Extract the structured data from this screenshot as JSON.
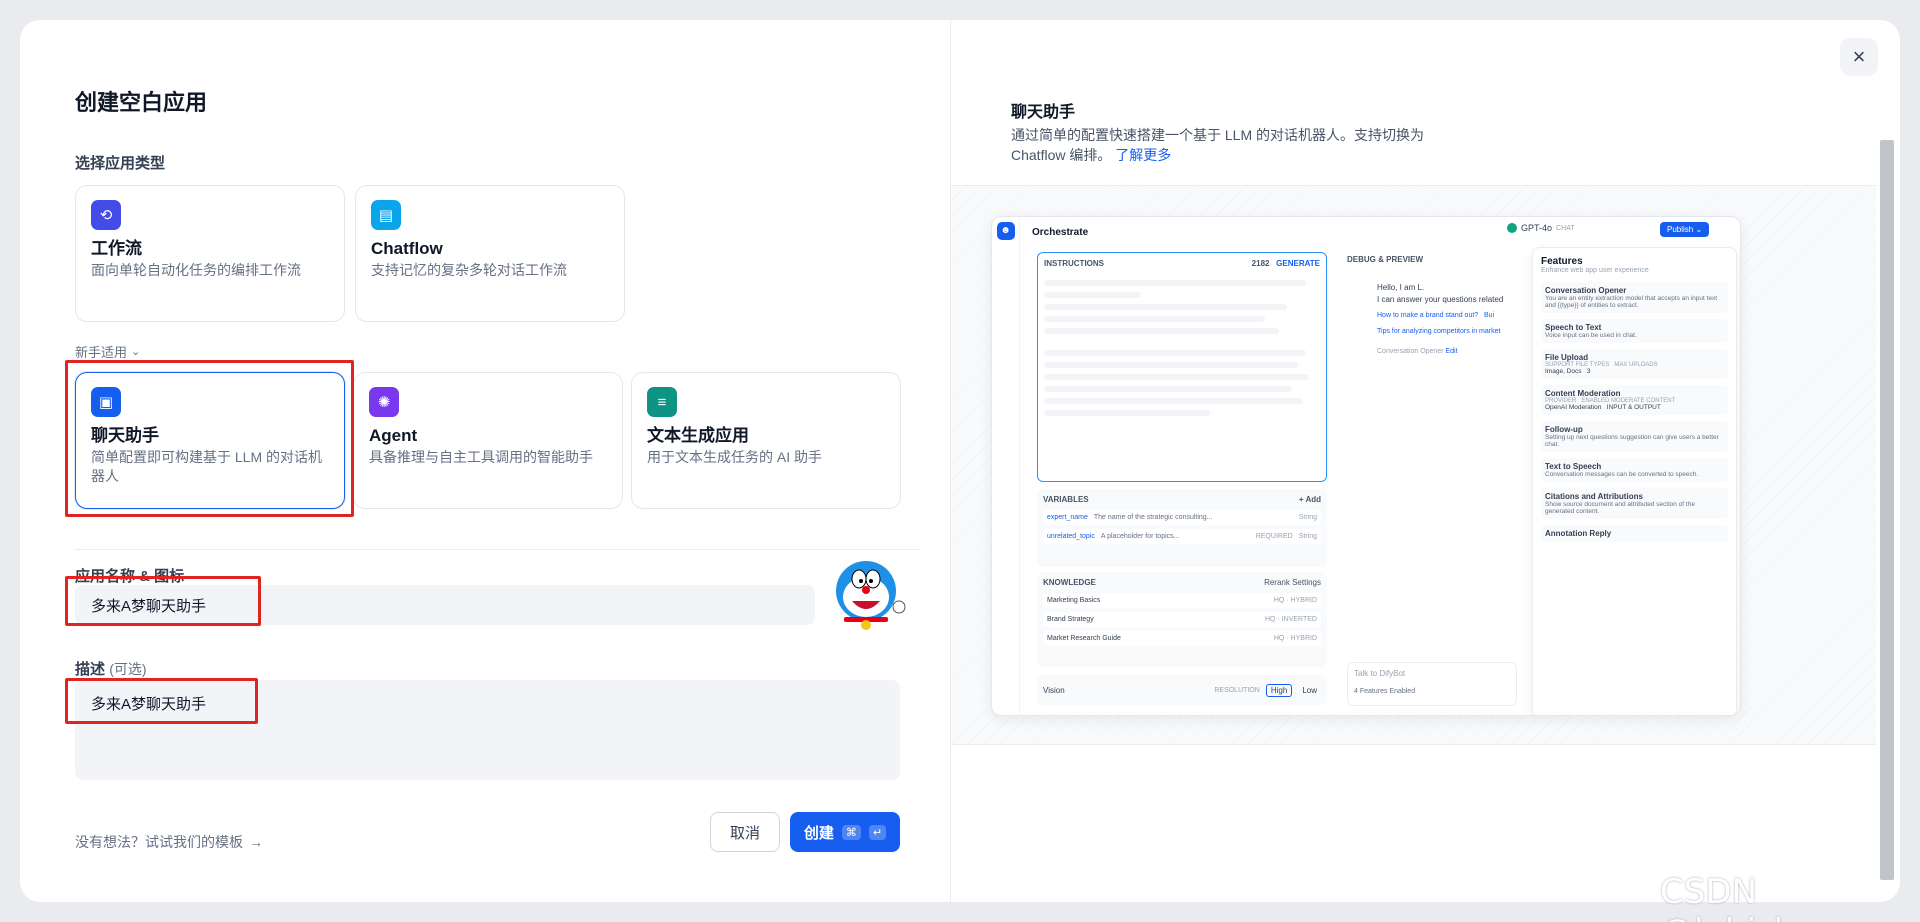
{
  "dialog": {
    "title": "创建空白应用",
    "type_label": "选择应用类型",
    "beginner_label": "新手适用",
    "name_label": "应用名称 & 图标",
    "name_value": "多来A梦聊天助手",
    "desc_label": "描述",
    "desc_optional": "(可选)",
    "desc_value": "多来A梦聊天助手",
    "template_link": "没有想法？试试我们的模板",
    "cancel_label": "取消",
    "create_label": "创建",
    "create_kbd_1": "⌘",
    "create_kbd_2": "↵"
  },
  "app_types": [
    {
      "name": "工作流",
      "desc": "面向单轮自动化任务的编排工作流",
      "icon": "workflow-icon",
      "color": "#444ce7"
    },
    {
      "name": "Chatflow",
      "desc": "支持记忆的复杂多轮对话工作流",
      "icon": "chatflow-icon",
      "color": "#0ba5ec"
    }
  ],
  "beginner_types": [
    {
      "name": "聊天助手",
      "desc": "简单配置即可构建基于 LLM 的对话机器人",
      "icon": "chatbot-icon",
      "color": "#155eef"
    },
    {
      "name": "Agent",
      "desc": "具备推理与自主工具调用的智能助手",
      "icon": "agent-icon",
      "color": "#7839ee"
    },
    {
      "name": "文本生成应用",
      "desc": "用于文本生成任务的 AI 助手",
      "icon": "text-generation-icon",
      "color": "#0e9384"
    }
  ],
  "preview": {
    "title": "聊天助手",
    "desc": "通过简单的配置快速搭建一个基于 LLM 的对话机器人。支持切换为 Chatflow 编排。",
    "learn_more": "了解更多",
    "orchestrate": "Orchestrate",
    "model": "GPT-4o",
    "model_tag": "CHAT",
    "publish": "Publish",
    "instructions": "INSTRUCTIONS",
    "instr_count": "2182",
    "generate": "GENERATE",
    "debug": "DEBUG & PREVIEW",
    "hello": "Hello, I am L.",
    "hello2": "I can answer your questions related",
    "q1": "How to make a brand stand out?",
    "q1b": "Bui",
    "q2": "Tips for analyzing competitors in market",
    "opener": "Conversation Opener",
    "edit": "Edit",
    "variables": "VARIABLES",
    "add": "+ Add",
    "var1": "expert_name",
    "var1_desc": "The name of the strategic consulting...",
    "var1_type": "String",
    "var2": "unrelated_topic",
    "var2_desc": "A placeholder for topics...",
    "var2_req": "REQUIRED",
    "var2_type": "String",
    "knowledge": "KNOWLEDGE",
    "rerank": "Rerank Settings",
    "k1": "Marketing Basics",
    "k1_tag": "HQ · HYBRID",
    "k2": "Brand Strategy",
    "k2_tag": "HQ · INVERTED",
    "k3": "Market Research Guide",
    "k3_tag": "HQ · HYBRID",
    "vision": "Vision",
    "resolution": "RESOLUTION",
    "high": "High",
    "low": "Low",
    "talk": "Talk to DifyBot",
    "features_enabled": "4 Features Enabled",
    "features": "Features",
    "features_sub": "Enhance web app user experience",
    "f1": "Conversation Opener",
    "f1d": "You are an entity extraction model that accepts an input text and {{type}} of entities to extract.",
    "f2": "Speech to Text",
    "f2d": "Voice input can be used in chat.",
    "f3": "File Upload",
    "f3a": "SUPPORT FILE TYPES",
    "f3b": "Image, Docs",
    "f3c": "MAX UPLOADS",
    "f3e": "3",
    "f4": "Content Moderation",
    "f4a": "PROVIDER",
    "f4b": "OpenAI Moderation",
    "f4c": "ENABLED MODERATE CONTENT",
    "f4e": "INPUT & OUTPUT",
    "f5": "Follow-up",
    "f5d": "Setting up next questions suggestion can give users a better chat.",
    "f6": "Text to Speech",
    "f6d": "Conversation messages can be converted to speech.",
    "f7": "Citations and Attributions",
    "f7d": "Show source document and attributed section of the generated content.",
    "f8": "Annotation Reply"
  },
  "watermark": "CSDN @lgbisha"
}
